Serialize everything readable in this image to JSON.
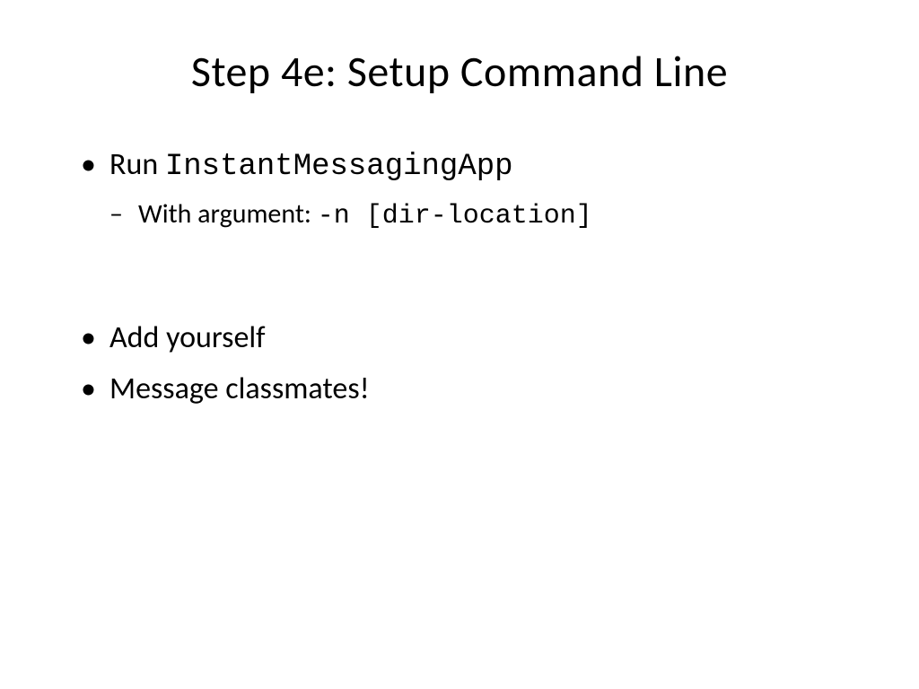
{
  "slide": {
    "title": "Step 4e: Setup Command Line",
    "bullets": {
      "b1_prefix": "Run ",
      "b1_code": "InstantMessagingApp",
      "b1_sub_prefix": "With argument: ",
      "b1_sub_code": "-n [dir-location]",
      "b2": "Add yourself",
      "b3": "Message classmates!"
    }
  }
}
